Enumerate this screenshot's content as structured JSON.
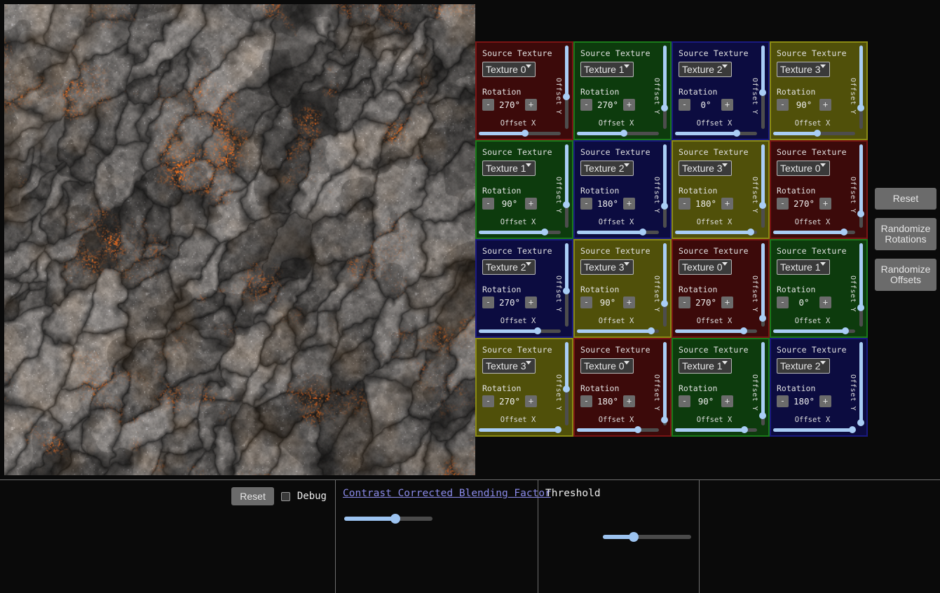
{
  "preview": {
    "name": "texture-blend-preview",
    "description": "Tiled rocky lava texture preview"
  },
  "grid": {
    "source_label": "Source Texture",
    "rotation_label": "Rotation",
    "offset_x_label": "Offset X",
    "offset_y_label": "Offset Y",
    "minus_label": "-",
    "plus_label": "+",
    "texture_options": [
      "Texture 0",
      "Texture 1",
      "Texture 2",
      "Texture 3"
    ],
    "colors": {
      "red": "#3c0a0a",
      "red_border": "#7a1414",
      "green": "#0d3b0d",
      "green_border": "#1a7a1a",
      "blue": "#0c0c40",
      "blue_border": "#1a1a80",
      "olive": "#50500a",
      "olive_border": "#8a8a14"
    },
    "cells": [
      {
        "texture": "Texture 0",
        "rotation": "270°",
        "offset_x": 0.56,
        "offset_y": 0.61,
        "theme": "red"
      },
      {
        "texture": "Texture 1",
        "rotation": "270°",
        "offset_x": 0.57,
        "offset_y": 0.75,
        "theme": "green"
      },
      {
        "texture": "Texture 2",
        "rotation": "0°",
        "offset_x": 0.75,
        "offset_y": 0.56,
        "theme": "blue"
      },
      {
        "texture": "Texture 3",
        "rotation": "90°",
        "offset_x": 0.54,
        "offset_y": 0.75,
        "theme": "olive"
      },
      {
        "texture": "Texture 1",
        "rotation": "90°",
        "offset_x": 0.8,
        "offset_y": 0.72,
        "theme": "green"
      },
      {
        "texture": "Texture 2",
        "rotation": "180°",
        "offset_x": 0.8,
        "offset_y": 0.74,
        "theme": "blue"
      },
      {
        "texture": "Texture 3",
        "rotation": "180°",
        "offset_x": 0.92,
        "offset_y": 0.73,
        "theme": "olive"
      },
      {
        "texture": "Texture 0",
        "rotation": "270°",
        "offset_x": 0.86,
        "offset_y": 0.83,
        "theme": "red"
      },
      {
        "texture": "Texture 2",
        "rotation": "270°",
        "offset_x": 0.72,
        "offset_y": 0.57,
        "theme": "blue"
      },
      {
        "texture": "Texture 3",
        "rotation": "90°",
        "offset_x": 0.91,
        "offset_y": 0.72,
        "theme": "olive"
      },
      {
        "texture": "Texture 0",
        "rotation": "270°",
        "offset_x": 0.84,
        "offset_y": 0.9,
        "theme": "red"
      },
      {
        "texture": "Texture 1",
        "rotation": "0°",
        "offset_x": 0.88,
        "offset_y": 0.77,
        "theme": "green"
      },
      {
        "texture": "Texture 3",
        "rotation": "270°",
        "offset_x": 0.97,
        "offset_y": 0.56,
        "theme": "olive"
      },
      {
        "texture": "Texture 0",
        "rotation": "180°",
        "offset_x": 0.74,
        "offset_y": 0.93,
        "theme": "red"
      },
      {
        "texture": "Texture 1",
        "rotation": "90°",
        "offset_x": 0.85,
        "offset_y": 0.88,
        "theme": "green"
      },
      {
        "texture": "Texture 2",
        "rotation": "180°",
        "offset_x": 0.97,
        "offset_y": 0.97,
        "theme": "blue"
      }
    ]
  },
  "side_buttons": [
    {
      "label": "Reset",
      "name": "reset-button"
    },
    {
      "label": "Randomize Rotations",
      "name": "randomize-rotations-button"
    },
    {
      "label": "Randomize Offsets",
      "name": "randomize-offsets-button"
    }
  ],
  "bottom": {
    "reset_label": "Reset",
    "debug_label": "Debug",
    "debug_checked": false,
    "blending_factor_label": "Contrast Corrected Blending Factor",
    "blending_factor_value": 0.58,
    "threshold_label": "Threshold",
    "threshold_value": 0.35
  }
}
